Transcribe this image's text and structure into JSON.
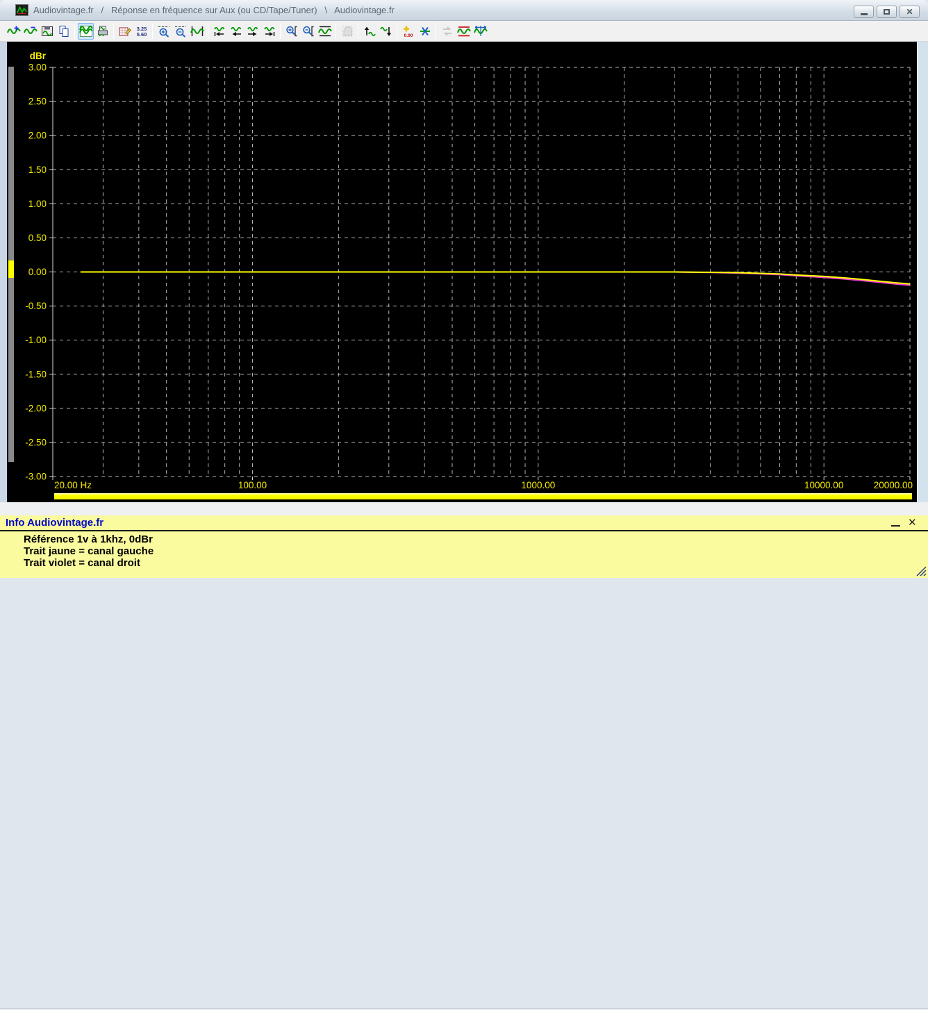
{
  "window": {
    "title": "Audiovintage.fr   /   Réponse en fréquence sur Aux (ou CD/Tape/Tuner)   \\   Audiovintage.fr",
    "controls": {
      "minimize": "minimize",
      "restore": "restore",
      "close": "close"
    }
  },
  "toolbar": {
    "items": [
      {
        "name": "add-trace"
      },
      {
        "name": "remove-trace"
      },
      {
        "name": "save-curve"
      },
      {
        "name": "copy-curve"
      },
      {
        "name": "view-curve",
        "selected": true
      },
      {
        "name": "print-curve"
      },
      {
        "name": "edit-data"
      },
      {
        "name": "show-values"
      },
      {
        "name": "zoom-in-horizontal"
      },
      {
        "name": "zoom-out-horizontal"
      },
      {
        "name": "fit-horizontal"
      },
      {
        "name": "scroll-to-start"
      },
      {
        "name": "scroll-left"
      },
      {
        "name": "scroll-right"
      },
      {
        "name": "scroll-to-end"
      },
      {
        "name": "zoom-in-vertical"
      },
      {
        "name": "zoom-out-vertical"
      },
      {
        "name": "fit-vertical"
      },
      {
        "name": "pan",
        "disabled": true
      },
      {
        "name": "move-up"
      },
      {
        "name": "move-down"
      },
      {
        "name": "reference-level-0.00"
      },
      {
        "name": "normalize"
      },
      {
        "name": "swap-traces",
        "disabled": true
      },
      {
        "name": "limit-lines"
      },
      {
        "name": "span-measure"
      }
    ]
  },
  "chart_data": {
    "type": "line",
    "title": "",
    "ylabel": "dBr",
    "xlabel": "",
    "x_scale": "log",
    "xlim": [
      20,
      20000
    ],
    "ylim": [
      -3,
      3
    ],
    "grid": "dashed",
    "grid_color": "#b4b4b4",
    "axis_color": "#d8d8d8",
    "label_color": "#f5ec00",
    "legend_position": "none",
    "y_tick_labels": [
      "3.00",
      "2.50",
      "2.00",
      "1.50",
      "1.00",
      "0.50",
      "0.00",
      "-0.50",
      "-1.00",
      "-1.50",
      "-2.00",
      "-2.50",
      "-3.00"
    ],
    "x_ticks": [
      {
        "label": "20.00 Hz",
        "value": 20,
        "anchor": "start"
      },
      {
        "label": "100.00",
        "value": 100
      },
      {
        "label": "1000.00",
        "value": 1000
      },
      {
        "label": "10000.00",
        "value": 10000
      },
      {
        "label": "20000.00",
        "value": 20000,
        "anchor": "end"
      }
    ],
    "series": [
      {
        "name": "canal gauche",
        "color": "#ffff00",
        "points": [
          [
            25,
            0
          ],
          [
            50,
            0
          ],
          [
            100,
            0
          ],
          [
            250,
            0
          ],
          [
            500,
            0
          ],
          [
            1000,
            0
          ],
          [
            2000,
            0
          ],
          [
            3000,
            0
          ],
          [
            4000,
            -0.005
          ],
          [
            5000,
            -0.01
          ],
          [
            6000,
            -0.02
          ],
          [
            7000,
            -0.03
          ],
          [
            8000,
            -0.045
          ],
          [
            9000,
            -0.055
          ],
          [
            10000,
            -0.065
          ],
          [
            12000,
            -0.09
          ],
          [
            14000,
            -0.115
          ],
          [
            16000,
            -0.14
          ],
          [
            18000,
            -0.16
          ],
          [
            20000,
            -0.175
          ]
        ]
      },
      {
        "name": "canal droit",
        "color": "#ee3cd2",
        "points": [
          [
            25,
            0
          ],
          [
            50,
            0
          ],
          [
            100,
            0
          ],
          [
            250,
            0
          ],
          [
            500,
            0
          ],
          [
            1000,
            0
          ],
          [
            2000,
            0
          ],
          [
            3000,
            0
          ],
          [
            4000,
            -0.008
          ],
          [
            5000,
            -0.016
          ],
          [
            6000,
            -0.027
          ],
          [
            7000,
            -0.04
          ],
          [
            8000,
            -0.056
          ],
          [
            9000,
            -0.068
          ],
          [
            10000,
            -0.08
          ],
          [
            12000,
            -0.106
          ],
          [
            14000,
            -0.132
          ],
          [
            16000,
            -0.157
          ],
          [
            18000,
            -0.178
          ],
          [
            20000,
            -0.197
          ]
        ]
      }
    ]
  },
  "info_panel": {
    "title": "Info Audiovintage.fr",
    "lines": [
      "Référence 1v à 1khz, 0dBr",
      "Trait jaune = canal gauche",
      "Trait violet = canal droit"
    ],
    "controls": {
      "minimize": "minimize",
      "close": "close"
    }
  },
  "colors": {
    "plot_background": "#000000",
    "trace_left": "#ffff00",
    "trace_right": "#ee3cd2",
    "info_background": "#fafa9e",
    "info_header": "#0008c8",
    "scrollbar": "#8a8a8a"
  }
}
